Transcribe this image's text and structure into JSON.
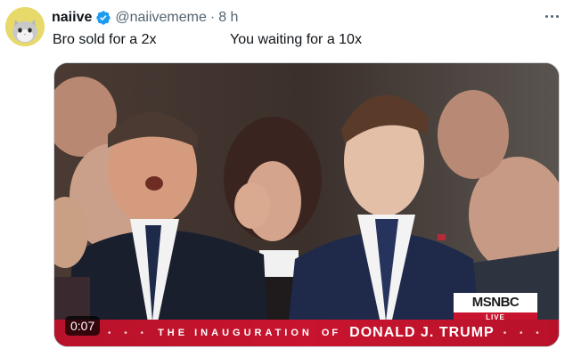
{
  "post": {
    "display_name": "naiive",
    "handle": "@naiivememe",
    "separator": "·",
    "time": "8 h",
    "text_left": "Bro sold for a 2x",
    "text_right": "You waiting for a 10x"
  },
  "media": {
    "duration": "0:07",
    "banner_title": "THE INAUGURATION",
    "banner_of": "OF",
    "banner_name": "DONALD J. TRUMP",
    "banner_dots_left": "• • •",
    "banner_dots_right": "• • •",
    "network_logo": "MSNBC",
    "network_live": "LIVE"
  },
  "colors": {
    "verified_badge": "#1d9bf0",
    "secondary_text": "#536471",
    "banner_red": "#c8142e"
  },
  "icons": {
    "verified": "verified-badge-icon",
    "more": "more-options-icon",
    "avatar": "cat-avatar"
  }
}
